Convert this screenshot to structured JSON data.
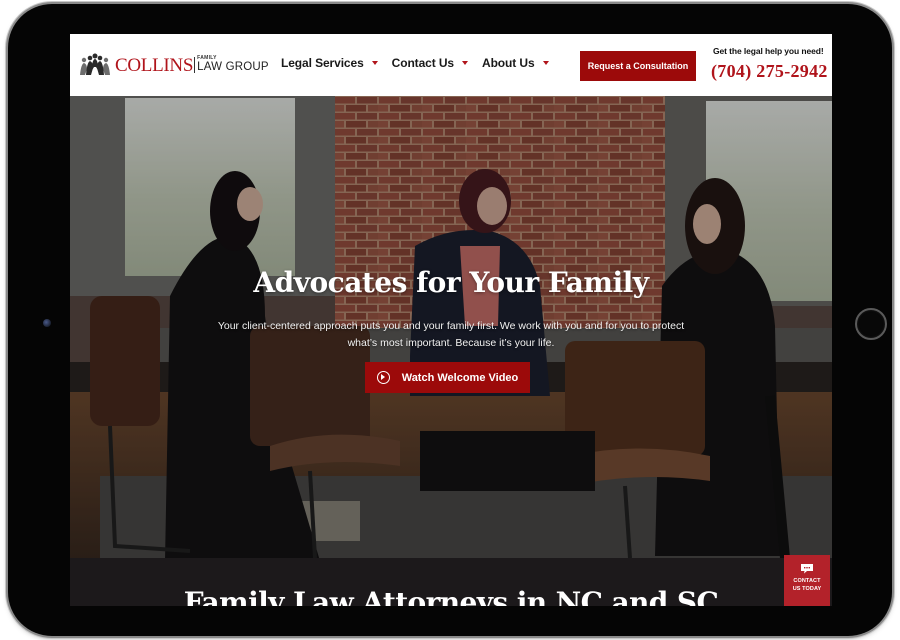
{
  "header": {
    "logo": {
      "brand_name": "COLLINS",
      "brand_small": "FAMILY",
      "brand_sub": "LAW GROUP"
    },
    "nav": [
      {
        "label": "Legal Services",
        "icon": "caret-down-icon"
      },
      {
        "label": "Contact Us",
        "icon": "caret-down-icon"
      },
      {
        "label": "About Us",
        "icon": "caret-down-icon"
      }
    ],
    "cta_label": "Request a Consultation",
    "help_text": "Get the legal help you need!",
    "phone": "(704) 275-2942"
  },
  "hero": {
    "title": "Advocates for Your Family",
    "subtitle_line1": "Your client-centered approach puts you and your family first. We work with you and for you to protect",
    "subtitle_line2": "what’s most important. Because it’s your life.",
    "video_button_label": "Watch Welcome Video",
    "video_button_icon": "play-circle-icon"
  },
  "section": {
    "title": "Family Law Attorneys in NC and SC"
  },
  "contact_float": {
    "icon": "chat-bubble-icon",
    "line1": "CONTACT",
    "line2": "US TODAY"
  },
  "colors": {
    "brand_red": "#b0141b",
    "button_red": "#9c0a0a",
    "float_red": "#b3222a",
    "dark_section": "#1c191b"
  }
}
